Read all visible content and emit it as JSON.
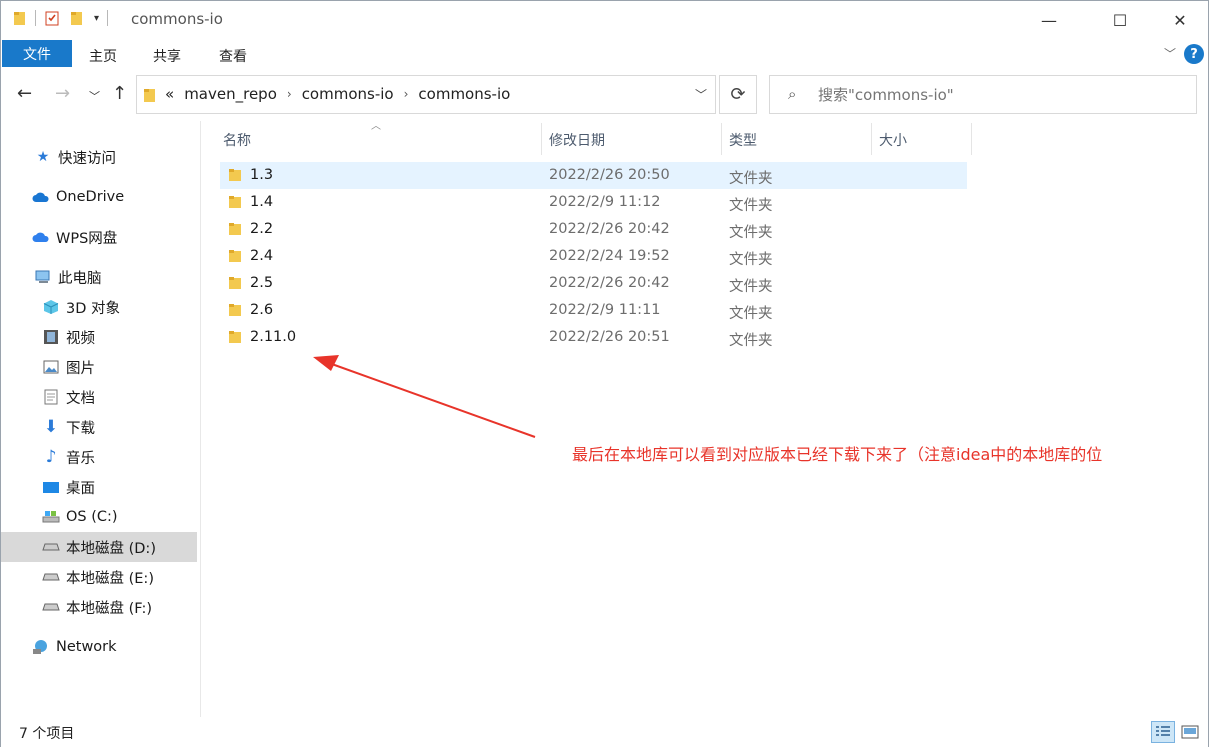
{
  "window": {
    "title": "commons-io",
    "controls": {
      "minimize": "—",
      "maximize": "☐",
      "close": "✕"
    }
  },
  "ribbon": {
    "file_tab": "文件",
    "tabs": [
      "主页",
      "共享",
      "查看"
    ],
    "help": "?"
  },
  "address": {
    "overflow": "«",
    "crumbs": [
      "maven_repo",
      "commons-io",
      "commons-io"
    ]
  },
  "search": {
    "placeholder": "搜索\"commons-io\""
  },
  "sidebar": {
    "items": [
      {
        "label": "快速访问",
        "icon": "star-icon"
      },
      {
        "label": "OneDrive",
        "icon": "cloud-icon"
      },
      {
        "label": "WPS网盘",
        "icon": "cloud-icon"
      },
      {
        "label": "此电脑",
        "icon": "computer-icon"
      },
      {
        "label": "3D 对象",
        "icon": "cube-icon"
      },
      {
        "label": "视频",
        "icon": "film-icon"
      },
      {
        "label": "图片",
        "icon": "picture-icon"
      },
      {
        "label": "文档",
        "icon": "document-icon"
      },
      {
        "label": "下载",
        "icon": "download-icon"
      },
      {
        "label": "音乐",
        "icon": "music-icon"
      },
      {
        "label": "桌面",
        "icon": "desktop-icon"
      },
      {
        "label": "OS (C:)",
        "icon": "drive-icon"
      },
      {
        "label": "本地磁盘 (D:)",
        "icon": "drive-icon"
      },
      {
        "label": "本地磁盘 (E:)",
        "icon": "drive-icon"
      },
      {
        "label": "本地磁盘 (F:)",
        "icon": "drive-icon"
      },
      {
        "label": "Network",
        "icon": "network-icon"
      }
    ],
    "selected": "本地磁盘 (D:)"
  },
  "columns": {
    "name": "名称",
    "date": "修改日期",
    "type": "类型",
    "size": "大小"
  },
  "files": [
    {
      "name": "1.3",
      "date": "2022/2/26 20:50",
      "type": "文件夹"
    },
    {
      "name": "1.4",
      "date": "2022/2/9 11:12",
      "type": "文件夹"
    },
    {
      "name": "2.2",
      "date": "2022/2/26 20:42",
      "type": "文件夹"
    },
    {
      "name": "2.4",
      "date": "2022/2/24 19:52",
      "type": "文件夹"
    },
    {
      "name": "2.5",
      "date": "2022/2/26 20:42",
      "type": "文件夹"
    },
    {
      "name": "2.6",
      "date": "2022/2/9 11:11",
      "type": "文件夹"
    },
    {
      "name": "2.11.0",
      "date": "2022/2/26 20:51",
      "type": "文件夹"
    }
  ],
  "annotation": {
    "text": "最后在本地库可以看到对应版本已经下载下来了（注意idea中的本地库的位",
    "color": "#e8342a"
  },
  "status": {
    "count_text": "7 个项目"
  },
  "colors": {
    "accent": "#1979ca",
    "selection": "#e5f3ff",
    "folder": "#f3c94f"
  }
}
